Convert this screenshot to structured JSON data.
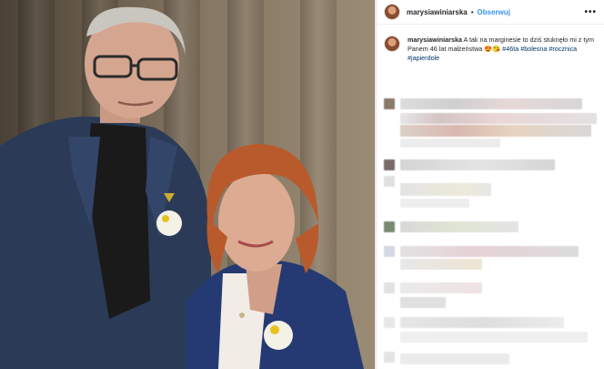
{
  "post": {
    "username": "marysiawiniarska",
    "follow_label": "Obserwuj",
    "separator": "•",
    "more_label": "•••"
  },
  "caption": {
    "username": "marysiawiniarska",
    "text": "A tak na marginesie to dziś stuknęło mi z tym Panem 46 lat małżeństwa",
    "emojis": "😍😘",
    "hashtags": [
      "#46ta",
      "#bolesna",
      "#rocznica",
      "#japierdole"
    ]
  },
  "colors": {
    "link_blue": "#3897f0",
    "hashtag": "#003569",
    "text": "#262626"
  }
}
